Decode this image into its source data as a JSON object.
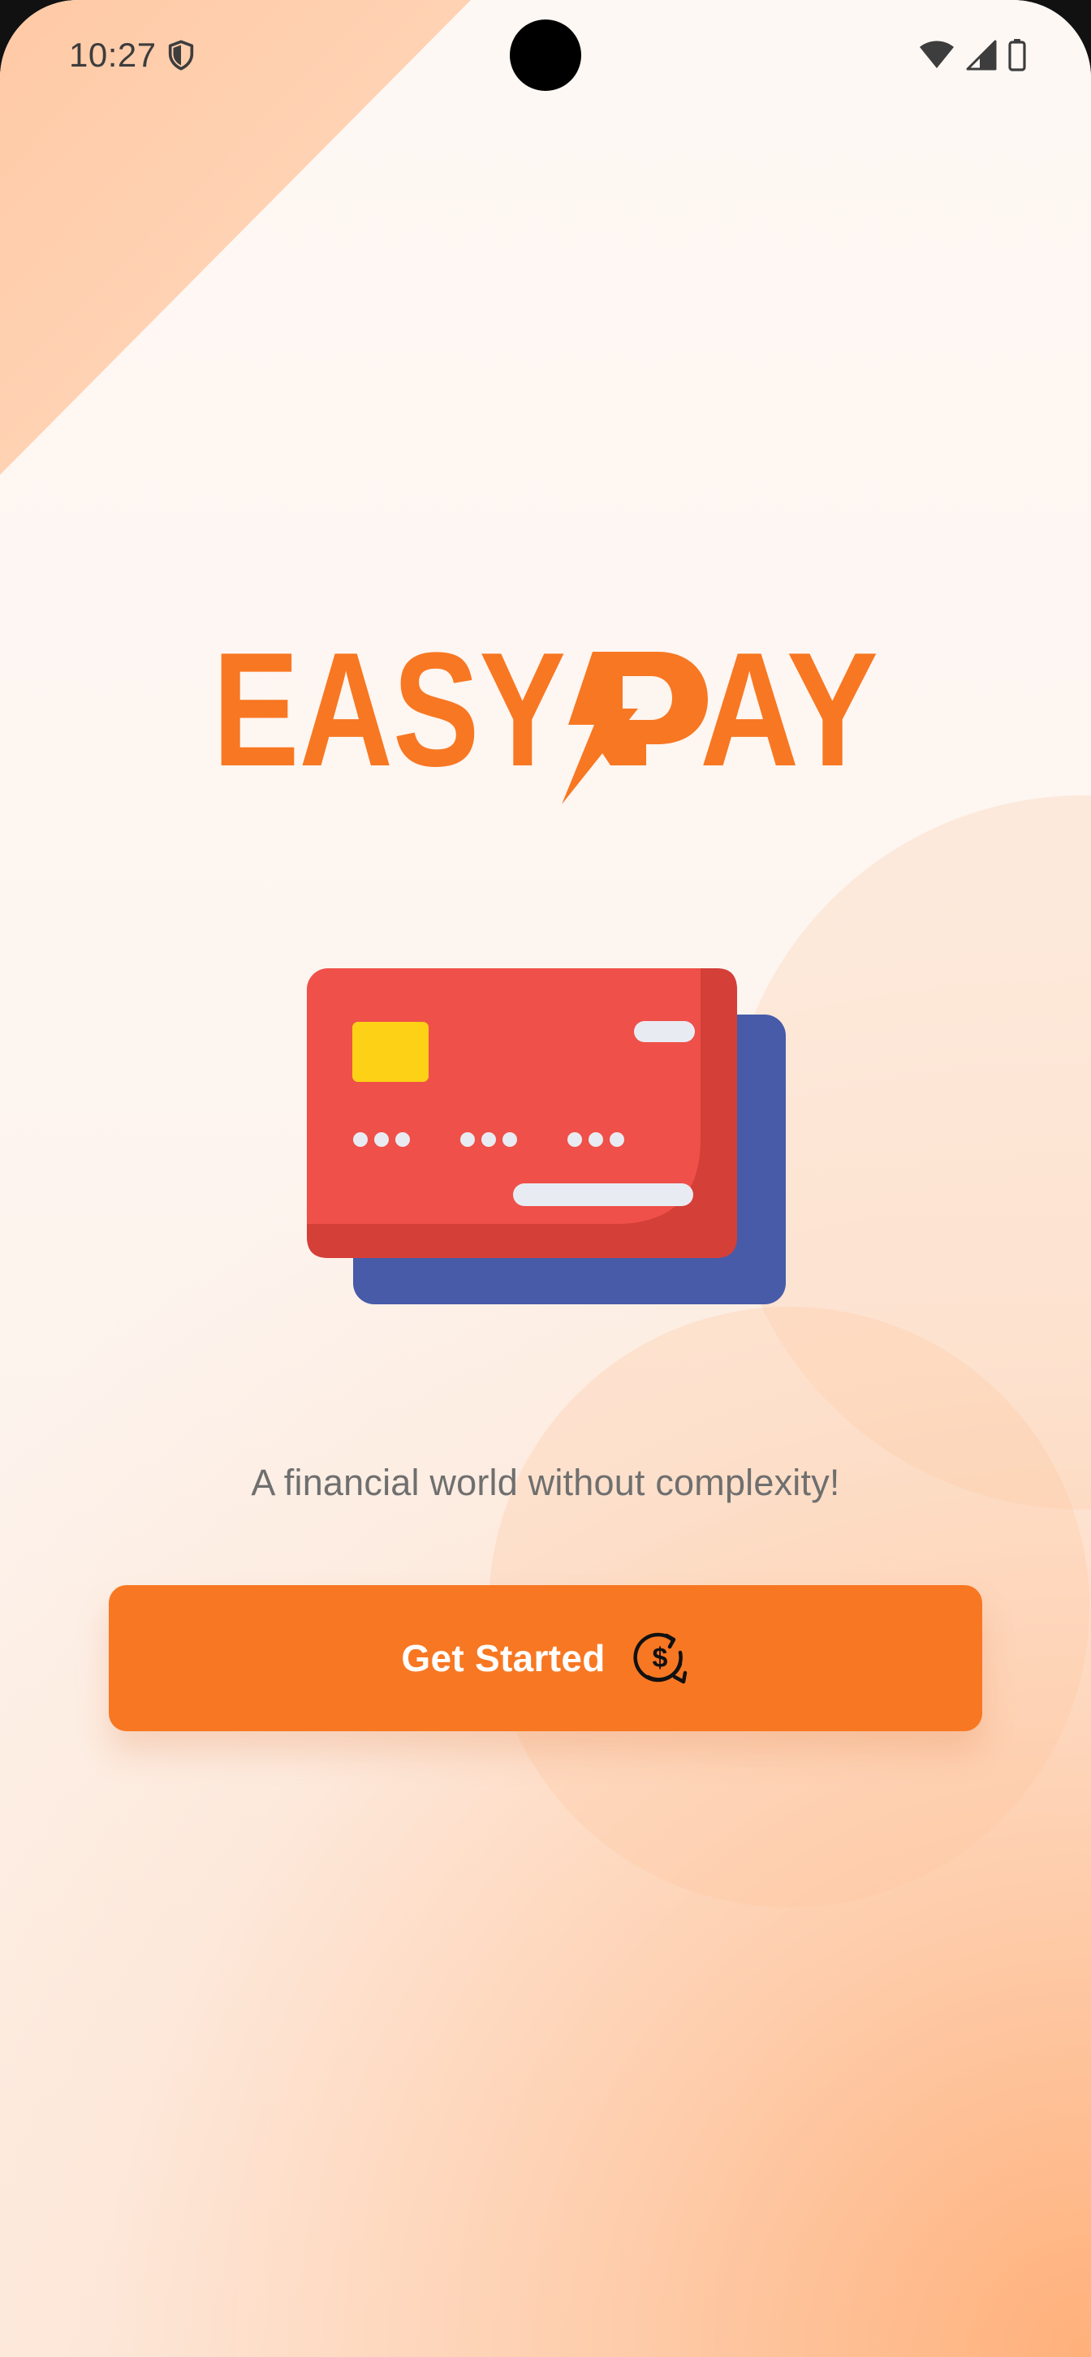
{
  "status_bar": {
    "time": "10:27",
    "icons": [
      "shield-icon",
      "wifi-icon",
      "cellular-signal-icon",
      "battery-icon"
    ]
  },
  "brand": {
    "name": "EASYPAY",
    "accent_color": "#f87722"
  },
  "illustration": {
    "icon": "credit-cards-icon",
    "front_card_color": "#ef5049",
    "back_card_color": "#475ba9",
    "chip_color": "#fcd116"
  },
  "tagline": "A financial world without complexity!",
  "cta": {
    "label": "Get Started",
    "icon": "dollar-refresh-icon",
    "background_color": "#f87722"
  }
}
